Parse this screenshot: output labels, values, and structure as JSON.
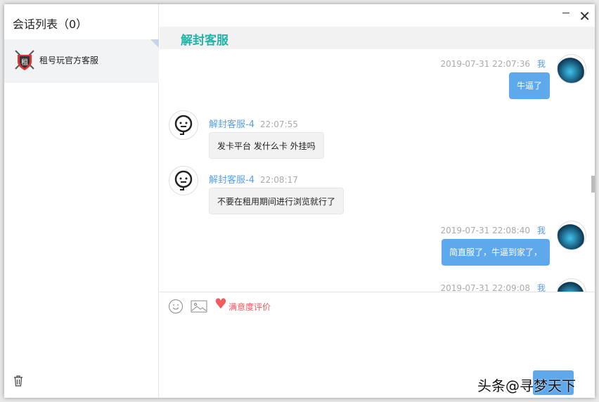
{
  "sidebar": {
    "title": "会话列表（0）",
    "conversations": [
      {
        "name": "租号玩官方客服"
      }
    ]
  },
  "chat": {
    "title": "解封客服",
    "messages": [
      {
        "from": "me",
        "time": "2019-07-31 22:07:36",
        "sender": "我",
        "text": "牛逼了"
      },
      {
        "from": "agent",
        "sender": "解封客服-4",
        "time": "22:07:55",
        "text": "发卡平台 发什么卡 外挂吗"
      },
      {
        "from": "agent",
        "sender": "解封客服-4",
        "time": "22:08:17",
        "text": "不要在租用期间进行浏览就行了"
      },
      {
        "from": "me",
        "time": "2019-07-31 22:08:40",
        "sender": "我",
        "text": "简直服了，牛逼到家了，"
      },
      {
        "from": "me",
        "time": "2019-07-31 22:09:08",
        "sender": "我",
        "text": ""
      }
    ]
  },
  "input": {
    "rating_label": "满意度评价"
  },
  "watermark": "头条@寻梦天下",
  "colors": {
    "accent": "#1fb5a8",
    "bubble": "#5ea8ec",
    "rating": "#f25c5c"
  }
}
